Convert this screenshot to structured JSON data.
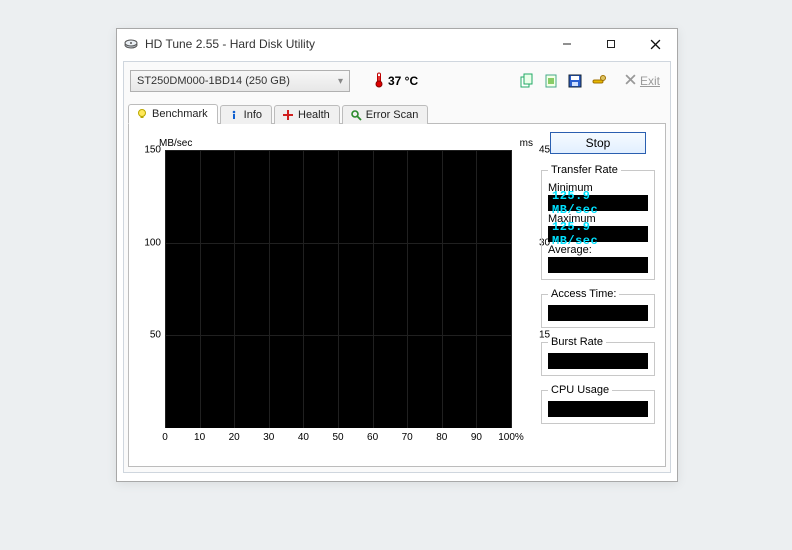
{
  "window": {
    "title": "HD Tune 2.55 - Hard Disk Utility",
    "controls": {
      "min": "—",
      "max": "▢",
      "close": "✕"
    }
  },
  "toolbar": {
    "drive": "ST250DM000-1BD14 (250 GB)",
    "temp": "37 °C",
    "exit_label": "Exit",
    "icons": [
      "copy-icon",
      "clipboard-icon",
      "save-icon",
      "options-icon"
    ]
  },
  "tabs": [
    {
      "id": "benchmark",
      "label": "Benchmark",
      "icon": "bulb"
    },
    {
      "id": "info",
      "label": "Info",
      "icon": "info"
    },
    {
      "id": "health",
      "label": "Health",
      "icon": "plus"
    },
    {
      "id": "errorscan",
      "label": "Error Scan",
      "icon": "search"
    }
  ],
  "active_tab": "benchmark",
  "chart_data": {
    "type": "line",
    "title": "",
    "x": {
      "label": "",
      "min": 0,
      "max": 100,
      "ticks": [
        0,
        10,
        20,
        30,
        40,
        50,
        60,
        70,
        80,
        90,
        100
      ],
      "suffix_last": "%"
    },
    "y_left": {
      "label": "MB/sec",
      "min": 0,
      "max": 150,
      "ticks": [
        150,
        100,
        50
      ]
    },
    "y_right": {
      "label": "ms",
      "min": 0,
      "max": 45,
      "ticks": [
        45,
        30,
        15
      ]
    },
    "series": [
      {
        "name": "Transfer Rate",
        "axis": "left",
        "x": [],
        "y": []
      },
      {
        "name": "Access Time",
        "axis": "right",
        "x": [],
        "y": []
      }
    ]
  },
  "panel": {
    "stop_label": "Stop",
    "transfer_rate": {
      "legend": "Transfer Rate",
      "min_label": "Minimum",
      "min_value": "125.9 MB/sec",
      "max_label": "Maximum",
      "max_value": "125.9 MB/sec",
      "avg_label": "Average:"
    },
    "access_time_label": "Access Time:",
    "burst_rate_label": "Burst Rate",
    "cpu_usage_label": "CPU Usage"
  }
}
